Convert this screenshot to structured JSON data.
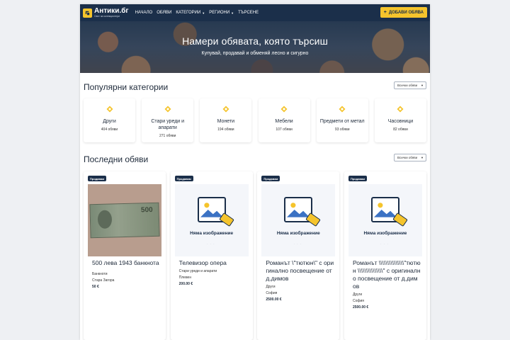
{
  "brand": {
    "name": "Антики.бг",
    "tagline": "Свят за колекционери"
  },
  "nav": {
    "items": [
      {
        "label": "НАЧАЛО",
        "dropdown": false
      },
      {
        "label": "ОБЯВИ",
        "dropdown": false
      },
      {
        "label": "КАТЕГОРИИ",
        "dropdown": true
      },
      {
        "label": "РЕГИОНИ",
        "dropdown": true
      },
      {
        "label": "ТЪРСЕНЕ",
        "dropdown": false
      }
    ],
    "add_button": "ДОБАВИ ОБЯВА"
  },
  "hero": {
    "title": "Намери обявата, която търсиш",
    "subtitle": "Купувай, продавай и обменяй лесно и сигурно"
  },
  "popular": {
    "title": "Популярни категории",
    "select": "Всички обяви",
    "categories": [
      {
        "name": "Други",
        "count": "404 обяви"
      },
      {
        "name": "Стари уреди и апарати",
        "count": "271 обяви"
      },
      {
        "name": "Монети",
        "count": "194 обяви"
      },
      {
        "name": "Мебели",
        "count": "107 обяви"
      },
      {
        "name": "Предмети от метал",
        "count": "93 обяви"
      },
      {
        "name": "Часовници",
        "count": "82 обяви"
      }
    ]
  },
  "latest": {
    "title": "Последни обяви",
    "select": "Всички обяви",
    "listings": [
      {
        "badge": "Продавам",
        "title": "500 лева 1943 банкнота",
        "category": "Банкноти",
        "location": "Стара Загора",
        "price": "50 €",
        "image": "banknote"
      },
      {
        "badge": "Продавам",
        "title": "Телевизор опера",
        "category": "Стари уреди и апарати",
        "location": "Плевен",
        "price": "200.00 €",
        "image": "placeholder",
        "no_image": "Няма изображение"
      },
      {
        "badge": "Продавам",
        "title": "Романът \\\"тютюн\\\" с оригинално посвещение от д.димов",
        "category": "Други",
        "location": "София",
        "price": "2500.00 €",
        "image": "placeholder",
        "no_image": "Няма изображение"
      },
      {
        "badge": "Продавам",
        "title": "Романът \\\\\\\\\\\\\\\\\\\\\\\\\\\\\\\"тютюн \\\\\\\\\\\\\\\\\\\\\\\\\\\\\\\" с оригинално посвещение от д.димов",
        "category": "Други",
        "location": "София",
        "price": "2500.00 €",
        "image": "placeholder",
        "no_image": "Няма изображение"
      }
    ]
  },
  "colors": {
    "navy": "#1b2f4a",
    "accent": "#f5c42c"
  }
}
